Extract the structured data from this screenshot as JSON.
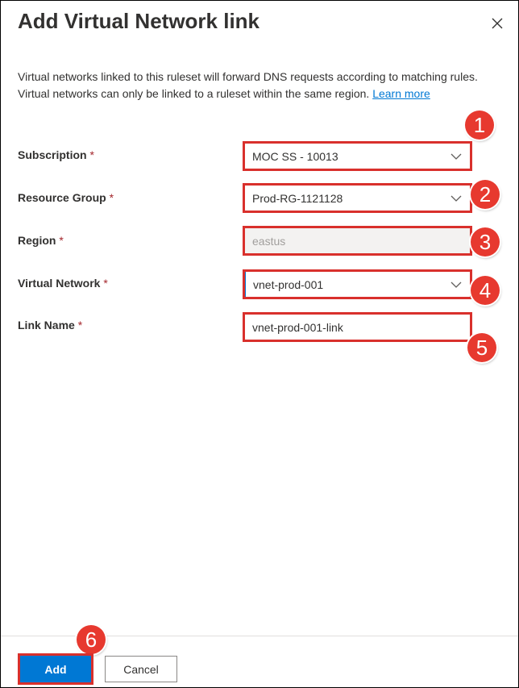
{
  "dialog": {
    "title": "Add Virtual Network link",
    "description": "Virtual networks linked to this ruleset will forward DNS requests according to matching rules. Virtual networks can only be linked to a ruleset within the same region.",
    "learn_more": "Learn more"
  },
  "form": {
    "required_marker": "*",
    "subscription": {
      "label": "Subscription",
      "value": "MOC SS - 10013"
    },
    "resource_group": {
      "label": "Resource Group",
      "value": "Prod-RG-1121128"
    },
    "region": {
      "label": "Region",
      "value": "eastus"
    },
    "virtual_network": {
      "label": "Virtual Network",
      "value": "vnet-prod-001"
    },
    "link_name": {
      "label": "Link Name",
      "value": "vnet-prod-001-link"
    }
  },
  "footer": {
    "add_label": "Add",
    "cancel_label": "Cancel"
  },
  "callouts": [
    "1",
    "2",
    "3",
    "4",
    "5",
    "6"
  ],
  "colors": {
    "accent": "#0078d4",
    "callout": "#e7392f",
    "highlight_border": "#d9302c",
    "required": "#a4262c"
  },
  "icons": {
    "close": "close-icon",
    "dropdown": "chevron-down-icon"
  }
}
